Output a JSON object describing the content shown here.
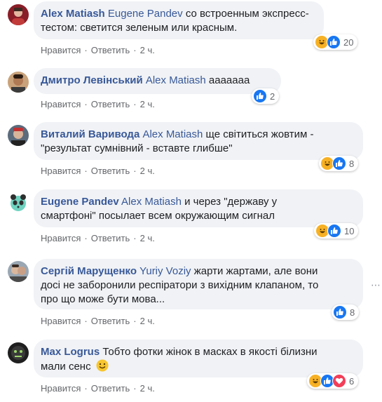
{
  "actions": {
    "like": "Нравится",
    "reply": "Ответить",
    "time": "2 ч.",
    "sep": "·"
  },
  "comments": [
    {
      "author": "Alex Matiash",
      "mention": "Eugene Pandev",
      "text_line1": "со встроенным экспресс-",
      "text_line2": "тестом: светится зеленым или красным.",
      "reactions": [
        "haha-icon",
        "like-icon"
      ],
      "count": "20"
    },
    {
      "author": "Дмитро Левінський",
      "mention": "Alex Matiash",
      "text_line1": "ааааааа",
      "reactions": [
        "like-icon"
      ],
      "count": "2"
    },
    {
      "author": "Виталий Варивода",
      "mention": "Alex Matiash",
      "text_line1": "ще світиться жовтим -",
      "text_line2": "\"результат сумнівний - вставте глибше\"",
      "reactions": [
        "haha-icon",
        "like-icon"
      ],
      "count": "8"
    },
    {
      "author": "Eugene Pandev",
      "mention": "Alex Matiash",
      "text_line1": "и через \"державу у",
      "text_line2": "смартфоні\" посылает всем окружающим сигнал",
      "reactions": [
        "haha-icon",
        "like-icon"
      ],
      "count": "10"
    },
    {
      "author": "Сергій Марущенко",
      "mention": "Yuriy Voziy",
      "text_line1": "жарти жартами, але вони",
      "text_line2": "досі не заборонили респіратори з вихідним клапаном, то",
      "text_line3": "про що може бути мова...",
      "reactions": [
        "like-icon"
      ],
      "count": "8"
    },
    {
      "author": "Max Logrus",
      "text_line1": "Тобто фотки жінок в масках в якості білизни",
      "text_line2": "мали сенс",
      "reactions": [
        "haha-icon",
        "like-icon",
        "love-icon"
      ],
      "count": "6"
    }
  ],
  "colors": {
    "link": "#385898",
    "bubble": "#f0f2f5",
    "like": "#1877f2",
    "haha": "#f7b125",
    "love": "#f33e58",
    "meta": "#65676b"
  }
}
